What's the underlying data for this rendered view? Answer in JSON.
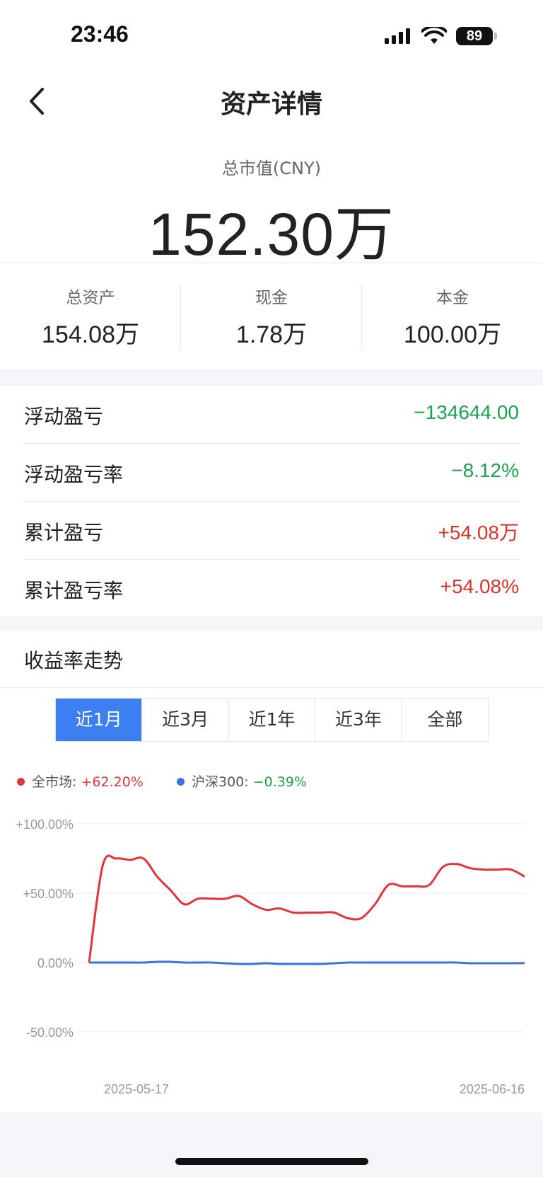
{
  "status_bar": {
    "time": "23:46",
    "battery": "89"
  },
  "header": {
    "title": "资产详情"
  },
  "summary": {
    "label": "总市值(CNY)",
    "value": "152.30万"
  },
  "stats": [
    {
      "label": "总资产",
      "value": "154.08万"
    },
    {
      "label": "现金",
      "value": "1.78万"
    },
    {
      "label": "本金",
      "value": "100.00万"
    }
  ],
  "pnl": [
    {
      "label": "浮动盈亏",
      "value": "−134644.00",
      "color": "#1aa34a"
    },
    {
      "label": "浮动盈亏率",
      "value": "−8.12%",
      "color": "#1aa34a"
    },
    {
      "label": "累计盈亏",
      "value": "+54.08万",
      "color": "#d9342b"
    },
    {
      "label": "累计盈亏率",
      "value": "+54.08%",
      "color": "#d9342b"
    }
  ],
  "trend": {
    "title": "收益率走势",
    "tabs": [
      "近1月",
      "近3月",
      "近1年",
      "近3年",
      "全部"
    ],
    "active_tab": 0
  },
  "legend": [
    {
      "name": "全市场",
      "value": "+62.20%",
      "color": "#e3343a",
      "value_color": "#e3343a"
    },
    {
      "name": "沪深300",
      "value": "−0.39%",
      "color": "#3b73d6",
      "value_color": "#1aa34a"
    }
  ],
  "chart_data": {
    "type": "line",
    "y_tick_labels": [
      "+100.00%",
      "+50.00%",
      "0.00%",
      "-50.00%"
    ],
    "ylim": [
      -50,
      100
    ],
    "x_tick_labels": [
      "2025-05-17",
      "2025-06-16"
    ],
    "grid": true,
    "series": [
      {
        "name": "全市场",
        "color": "#e3343a",
        "values": [
          0,
          70,
          75,
          74,
          75,
          62,
          52,
          42,
          46,
          46,
          46,
          48,
          42,
          38,
          39,
          36,
          36,
          36,
          36,
          32,
          32,
          42,
          56,
          55,
          55,
          56,
          69,
          71,
          68,
          67,
          67,
          67,
          62
        ]
      },
      {
        "name": "沪深300",
        "color": "#3b73d6",
        "values": [
          0,
          0,
          0,
          0,
          0,
          0.5,
          0.5,
          0,
          0,
          0,
          -0.5,
          -1,
          -1,
          -0.5,
          -1,
          -1,
          -1,
          -1,
          -0.5,
          0,
          0,
          0,
          0,
          0,
          0,
          0,
          0,
          0,
          -0.5,
          -0.5,
          -0.5,
          -0.5,
          -0.4
        ]
      }
    ]
  }
}
